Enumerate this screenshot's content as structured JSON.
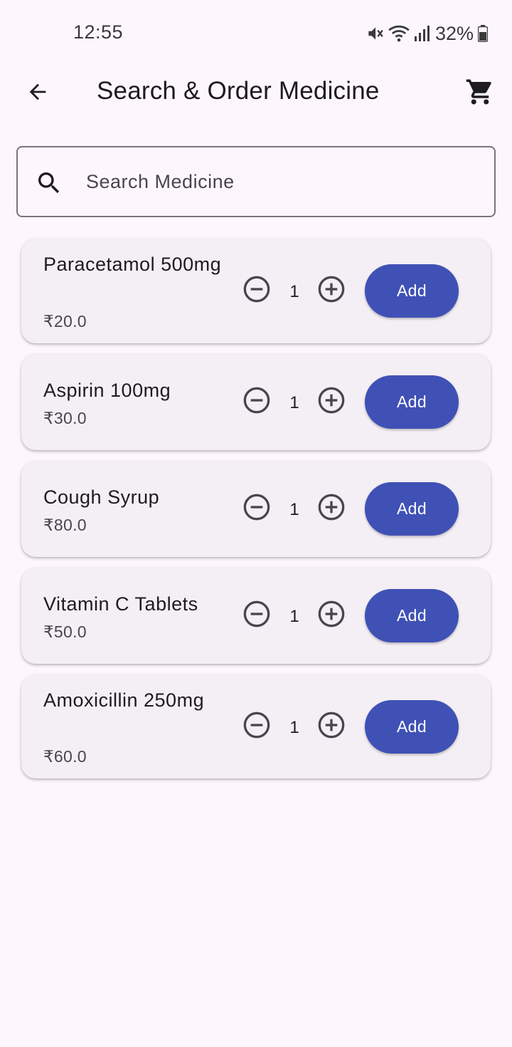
{
  "status_bar": {
    "time": "12:55",
    "battery": "32%",
    "icons": [
      "mute-icon",
      "wifi-icon",
      "signal-icon",
      "battery-icon"
    ]
  },
  "app_bar": {
    "back_icon": "arrow-back-icon",
    "title": "Search & Order Medicine",
    "cart_icon": "shopping-cart-icon"
  },
  "search": {
    "icon": "search-icon",
    "placeholder": "Search Medicine",
    "value": ""
  },
  "medicines": [
    {
      "name": "Paracetamol 500mg",
      "price": "₹20.0",
      "quantity": "1",
      "add_label": "Add"
    },
    {
      "name": "Aspirin 100mg",
      "price": "₹30.0",
      "quantity": "1",
      "add_label": "Add"
    },
    {
      "name": "Cough Syrup",
      "price": "₹80.0",
      "quantity": "1",
      "add_label": "Add"
    },
    {
      "name": "Vitamin C Tablets",
      "price": "₹50.0",
      "quantity": "1",
      "add_label": "Add"
    },
    {
      "name": "Amoxicillin 250mg",
      "price": "₹60.0",
      "quantity": "1",
      "add_label": "Add"
    }
  ],
  "colors": {
    "background": "#fdf7fd",
    "card": "#f4eff5",
    "accent": "#3f51b5",
    "text": "#1d1b20",
    "secondary_text": "#49454f"
  }
}
